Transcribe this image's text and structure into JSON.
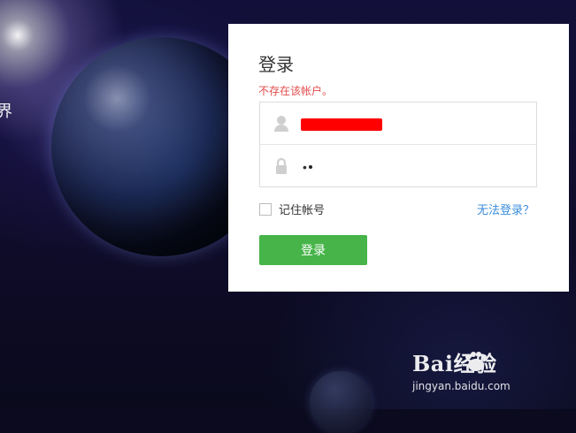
{
  "background": {
    "left_glyph": "界"
  },
  "login": {
    "title": "登录",
    "error_message": "不存在该帐户。",
    "username": {
      "value": "",
      "redacted": true
    },
    "password": {
      "value": "•"
    },
    "remember_label": "记住帐号",
    "forgot_label": "无法登录？",
    "submit_label": "登录"
  },
  "watermark": {
    "logo_text": "Bai经验",
    "url_text": "jingyan.baidu.com"
  },
  "colors": {
    "error": "#e24b4b",
    "link": "#3b8ddc",
    "button": "#46b448",
    "redaction": "#ff0000"
  },
  "icons": {
    "user": "user-icon",
    "lock": "lock-icon",
    "paw": "baidu-paw-icon"
  }
}
